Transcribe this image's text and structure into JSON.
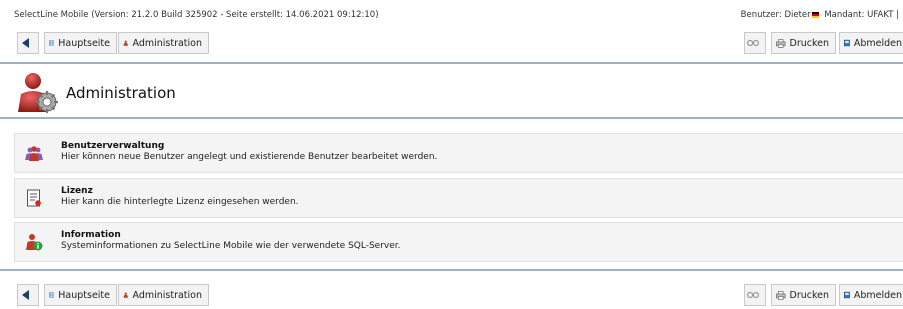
{
  "header": {
    "version_info": "SelectLine Mobile (Version: 21.2.0 Build 325902 - Seite erstellt: 14.06.2021 09:12:10)",
    "user_label": "Benutzer: Dieter",
    "client_label": "Mandant: UFAKT",
    "separator": "|"
  },
  "toolbar": {
    "home_label": "Hauptseite",
    "admin_label": "Administration",
    "print_label": "Drucken",
    "logout_label": "Abmelden"
  },
  "page": {
    "title": "Administration"
  },
  "items": [
    {
      "title": "Benutzerverwaltung",
      "description": "Hier können neue Benutzer angelegt und existierende Benutzer bearbeitet werden.",
      "icon": "users-icon"
    },
    {
      "title": "Lizenz",
      "description": "Hier kann die hinterlegte Lizenz eingesehen werden.",
      "icon": "license-document-icon"
    },
    {
      "title": "Information",
      "description": "Systeminformationen zu SelectLine Mobile wie der verwendete SQL-Server.",
      "icon": "info-user-icon"
    }
  ],
  "colors": {
    "rule": "#9fb0c4",
    "admin_red": "#c0392b",
    "item_bg": "#f4f4f4"
  }
}
